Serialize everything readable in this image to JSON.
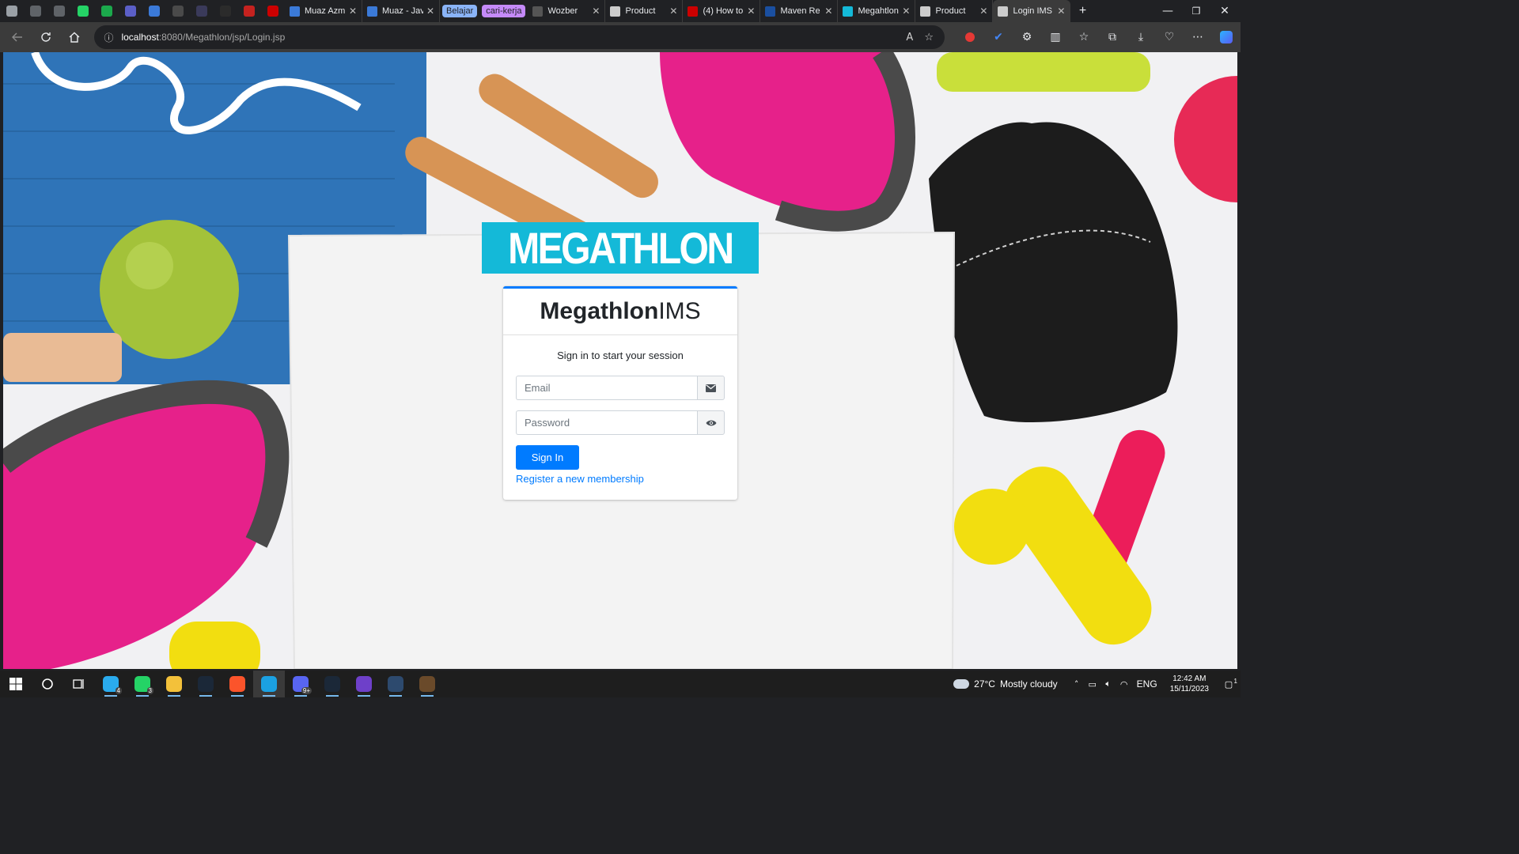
{
  "browser": {
    "pinned_tabs": [
      {
        "icon": "profile-icon",
        "color": "#9aa0a6"
      },
      {
        "icon": "workspaces-icon",
        "color": "#5f6368"
      },
      {
        "icon": "tab-actions-icon",
        "color": "#5f6368"
      },
      {
        "icon": "whatsapp-icon",
        "color": "#25d366"
      },
      {
        "icon": "app-icon",
        "color": "#1ba94c"
      },
      {
        "icon": "teams-icon",
        "color": "#5b5fc7"
      },
      {
        "icon": "app-icon",
        "color": "#3b7ad8"
      },
      {
        "icon": "app-icon",
        "color": "#4a4a4a"
      },
      {
        "icon": "app-icon",
        "color": "#3a3a5a"
      },
      {
        "icon": "github-icon",
        "color": "#2b2b2b"
      },
      {
        "icon": "gmail-icon",
        "color": "#c5221f"
      },
      {
        "icon": "youtube-icon",
        "color": "#cc0000"
      }
    ],
    "tabs": [
      {
        "label": "Muaz Azm",
        "icon": "app-icon",
        "color": "#3b7ad8"
      },
      {
        "label": "Muaz - Jav",
        "icon": "app-icon",
        "color": "#3b7ad8"
      }
    ],
    "tab_groups": [
      {
        "label": "Belajar",
        "color": "#8ab4f8"
      },
      {
        "label": "cari-kerja",
        "color": "#c58af9"
      }
    ],
    "tabs_after": [
      {
        "label": "Wozber",
        "icon": "app-icon",
        "color": "#555555"
      },
      {
        "label": "Product",
        "icon": "page-icon",
        "color": "#cccccc"
      },
      {
        "label": "(4) How to",
        "icon": "youtube-icon",
        "color": "#cc0000"
      },
      {
        "label": "Maven Re",
        "icon": "app-icon",
        "color": "#1a4fa0"
      },
      {
        "label": "Megahtlon",
        "icon": "app-icon",
        "color": "#14b9d8"
      },
      {
        "label": "Product",
        "icon": "page-icon",
        "color": "#cccccc"
      }
    ],
    "active_tab": {
      "label": "Login IMS",
      "icon": "page-icon",
      "color": "#cccccc"
    },
    "new_tab": "+",
    "url_host": "localhost",
    "url_path": ":8080/Megathlon/jsp/Login.jsp"
  },
  "page": {
    "logo_text": "MEGATHLON",
    "brand_bold": "Megathlon",
    "brand_light": "IMS",
    "login_message": "Sign in to start your session",
    "email_placeholder": "Email",
    "password_placeholder": "Password",
    "signin_label": "Sign In",
    "register_label": "Register a new membership",
    "colors": {
      "banner": "#14b9d8",
      "primary": "#007bff",
      "card_border": "#007bff"
    }
  },
  "taskbar": {
    "apps": [
      {
        "icon": "telegram-icon",
        "color": "#2aabee",
        "badge": "4"
      },
      {
        "icon": "whatsapp-icon",
        "color": "#25d366",
        "badge": "3"
      },
      {
        "icon": "file-explorer-icon",
        "color": "#f3c13a",
        "badge": ""
      },
      {
        "icon": "steam-icon",
        "color": "#1b2838",
        "badge": ""
      },
      {
        "icon": "brave-icon",
        "color": "#fb542b",
        "badge": ""
      },
      {
        "icon": "edge-icon",
        "color": "#1ba1e2",
        "badge": ""
      },
      {
        "icon": "discord-icon",
        "color": "#5865f2",
        "badge": "9+"
      },
      {
        "icon": "steam-icon",
        "color": "#1b2838",
        "badge": ""
      },
      {
        "icon": "github-desktop-icon",
        "color": "#6e40c9",
        "badge": ""
      },
      {
        "icon": "app-icon",
        "color": "#2d4a6e",
        "badge": ""
      },
      {
        "icon": "game-icon",
        "color": "#6a4a2a",
        "badge": ""
      }
    ],
    "weather_temp": "27°C",
    "weather_desc": "Mostly cloudy",
    "language": "ENG",
    "time": "12:42 AM",
    "date": "15/11/2023",
    "notification_count": "1"
  }
}
